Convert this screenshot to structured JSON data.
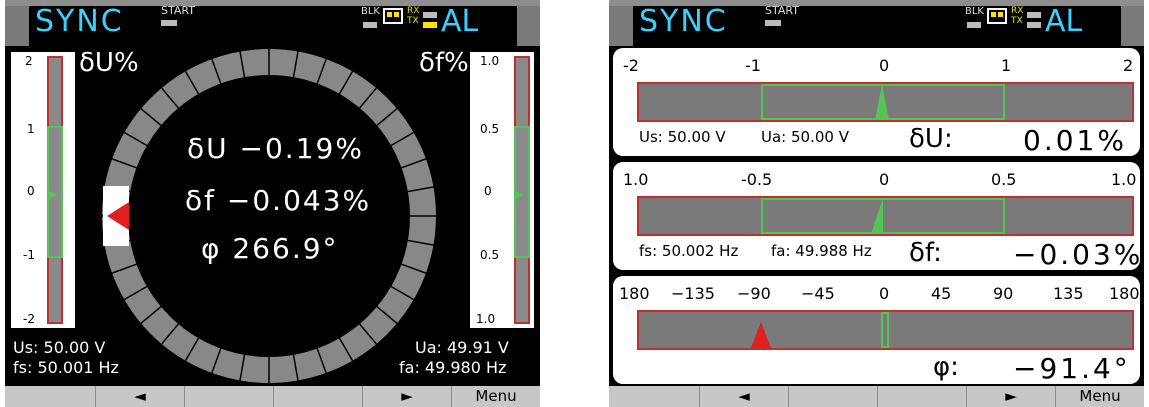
{
  "screenA": {
    "header": {
      "title": "SYNC",
      "start": "START",
      "blk": "BLK",
      "rx": "RX",
      "tx": "TX",
      "al": "AL"
    },
    "left_scale": {
      "label": "δU%",
      "ticks": [
        "2",
        "1",
        "0",
        "-1",
        "-2"
      ]
    },
    "right_scale": {
      "label": "δf%",
      "ticks": [
        "1.0",
        "0.5",
        "0",
        "0.5",
        "1.0"
      ]
    },
    "readouts": {
      "du": "δU  −0.19%",
      "df": "δf  −0.043%",
      "phi": "φ  266.9°"
    },
    "info_left": {
      "us": "Us: 50.00 V",
      "fs": "fs: 50.001 Hz"
    },
    "info_right": {
      "ua": "Ua: 49.91 V",
      "fa": "fa: 49.980 Hz"
    },
    "buttons": [
      "",
      "◄",
      "",
      "",
      "►",
      "Menu"
    ]
  },
  "screenB": {
    "header": {
      "title": "SYNC",
      "start": "START",
      "blk": "BLK",
      "rx": "RX",
      "tx": "TX",
      "al": "AL"
    },
    "du_panel": {
      "ticks": [
        "-2",
        "-1",
        "0",
        "1",
        "2"
      ],
      "us": "Us: 50.00 V",
      "ua": "Ua: 50.00 V",
      "param": "δU:",
      "value": "0.01%"
    },
    "df_panel": {
      "ticks": [
        "1.0",
        "-0.5",
        "0",
        "0.5",
        "1.0"
      ],
      "fs": "fs: 50.002 Hz",
      "fa": "fa: 49.988 Hz",
      "param": "δf:",
      "value": "−0.03%"
    },
    "phi_panel": {
      "ticks": [
        "180",
        "−135",
        "−90",
        "−45",
        "0",
        "45",
        "90",
        "135",
        "180"
      ],
      "param": "φ:",
      "value": "−91.4°"
    },
    "buttons": [
      "",
      "◄",
      "",
      "",
      "►",
      "Menu"
    ]
  },
  "colors": {
    "cyan": "#3ad0ff",
    "red": "#c03030",
    "green": "#55c455",
    "bar": "#7a7a7a"
  }
}
